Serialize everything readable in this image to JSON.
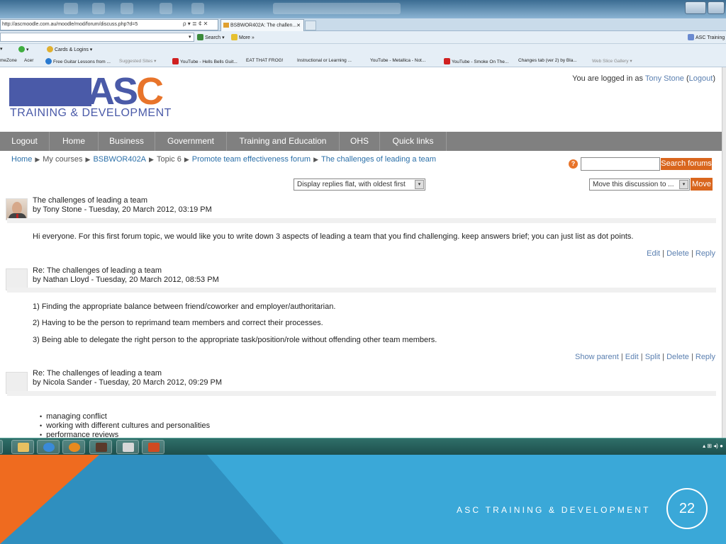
{
  "browser": {
    "address": "http://ascmoodle.com.au/moodle/mod/forum/discuss.php?d=5",
    "address_icons": "ρ ▾ ≣ ¢ ✕",
    "tab_title": "BSBWOR402A: The challen...",
    "tab_close": "✕",
    "command_items": [
      "Search",
      "More »",
      "ASC Training"
    ],
    "menu_items": [
      "Cards & Logins"
    ],
    "favorites": [
      "meZone",
      "Acer",
      "Free Guitar Lessons from ...",
      "Suggested Sites ▾",
      "YouTube - Hells Bells Guit...",
      "EAT THAT FROG!",
      "Instructional or Learning ...",
      "YouTube - Metallica - Not...",
      "YouTube - Smoke On The...",
      "Changes tab (ver 2) by Bla...",
      "Web Slice Gallery ▾"
    ]
  },
  "header": {
    "logo_text": "ASC",
    "logo_sub": "TRAINING & DEVELOPMENT",
    "login_prefix": "You are logged in as",
    "login_user": "Tony Stone",
    "login_logout": "Logout"
  },
  "nav": [
    "Logout",
    "Home",
    "Business",
    "Government",
    "Training and Education",
    "OHS",
    "Quick links"
  ],
  "breadcrumb": [
    "Home",
    "My courses",
    "BSBWOR402A",
    "Topic 6",
    "Promote team effectiveness forum",
    "The challenges of leading a team"
  ],
  "search": {
    "button": "Search forums",
    "help": "?"
  },
  "controls": {
    "display_mode": "Display replies flat, with oldest first",
    "move_select": "Move this discussion to ...",
    "move_button": "Move"
  },
  "posts": [
    {
      "title": "The challenges of leading a team",
      "byline": "by Tony Stone - Tuesday, 20 March 2012, 03:19 PM",
      "body": [
        "Hi everyone. For this first forum topic, we would like you to write down 3 aspects of leading a team that you find challenging. keep answers brief; you can just list as dot points."
      ],
      "links": [
        "Edit",
        "Delete",
        "Reply"
      ]
    },
    {
      "title": "Re: The challenges of leading a team",
      "byline": "by Nathan Lloyd - Tuesday, 20 March 2012, 08:53 PM",
      "body": [
        "1) Finding the appropriate balance between friend/coworker and employer/authoritarian.",
        "2) Having to be the person to reprimand team members and correct their processes.",
        "3) Being able to delegate the right person to the appropriate task/position/role without offending other team members."
      ],
      "links": [
        "Show parent",
        "Edit",
        "Split",
        "Delete",
        "Reply"
      ]
    },
    {
      "title": "Re: The challenges of leading a team",
      "byline": "by Nicola Sander - Tuesday, 20 March 2012, 09:29 PM",
      "bullets": [
        "managing conflict",
        "working with different cultures and personalities",
        "performance reviews"
      ]
    }
  ],
  "taskbar": {
    "tray": "▴ ⊞ ◂) ●"
  },
  "slide": {
    "footer": "ASC TRAINING & DEVELOPMENT",
    "page_number": "22"
  },
  "colors": {
    "accent_orange": "#d9661e",
    "logo_blue": "#4a5aa8",
    "slide_blue": "#3aa8d8"
  }
}
